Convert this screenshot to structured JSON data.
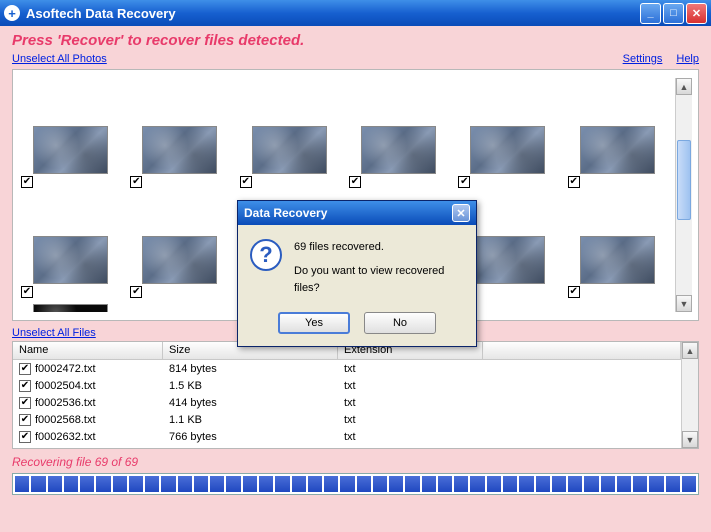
{
  "window": {
    "title": "Asoftech Data Recovery"
  },
  "instruction": "Press 'Recover' to recover files detected.",
  "links": {
    "unselect_photos": "Unselect All Photos",
    "unselect_files": "Unselect All Files",
    "settings": "Settings",
    "help": "Help"
  },
  "filetable": {
    "columns": {
      "name": "Name",
      "size": "Size",
      "ext": "Extension"
    },
    "rows": [
      {
        "name": "f0002472.txt",
        "size": "814 bytes",
        "ext": "txt"
      },
      {
        "name": "f0002504.txt",
        "size": "1.5 KB",
        "ext": "txt"
      },
      {
        "name": "f0002536.txt",
        "size": "414 bytes",
        "ext": "txt"
      },
      {
        "name": "f0002568.txt",
        "size": "1.1 KB",
        "ext": "txt"
      },
      {
        "name": "f0002632.txt",
        "size": "766 bytes",
        "ext": "txt"
      }
    ]
  },
  "status": "Recovering file 69 of 69",
  "progress": {
    "segments": 42
  },
  "dialog": {
    "title": "Data Recovery",
    "line1": "69 files recovered.",
    "line2": "Do you want to view recovered files?",
    "yes": "Yes",
    "no": "No"
  }
}
